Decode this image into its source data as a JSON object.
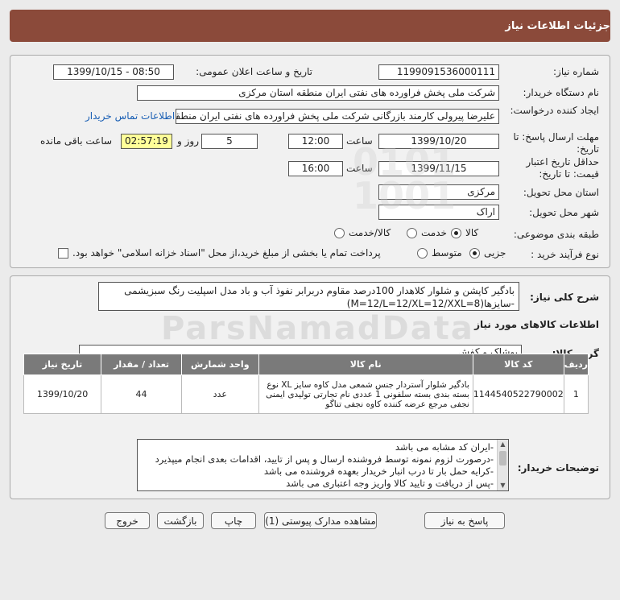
{
  "header": {
    "title": "جزئیات اطلاعات نیاز"
  },
  "form": {
    "need_number_label": "شماره نیاز:",
    "need_number": "1199091536000111",
    "announce_label": "تاریخ و ساعت اعلان عمومی:",
    "announce_value": "1399/10/15 - 08:50",
    "buyer_org_label": "نام دستگاه خریدار:",
    "buyer_org": "شرکت ملی پخش فراورده های نفتی ایران منطقه استان مرکزی",
    "creator_label": "ایجاد کننده درخواست:",
    "creator": "علیرضا پیرولی کارمند بازرگانی شرکت ملی پخش فراورده های نفتی ایران منطقه",
    "contact_link": "اطلاعات تماس خریدار",
    "reply_deadline_label": "مهلت ارسال پاسخ: تا تاریخ:",
    "reply_date": "1399/10/20",
    "time_label": "ساعت",
    "reply_time": "12:00",
    "days_value": "5",
    "days_label": "روز و",
    "remaining_time": "02:57:19",
    "remaining_label": "ساعت باقی مانده",
    "price_validity_label": "حداقل تاریخ اعتبار قیمت: تا تاریخ:",
    "validity_date": "1399/11/15",
    "validity_time": "16:00",
    "province_label": "استان محل تحویل:",
    "province": "مرکزی",
    "city_label": "شهر محل تحویل:",
    "city": "اراک",
    "category_label": "طبقه بندی موضوعی:",
    "category_options": [
      "کالا",
      "خدمت",
      "کالا/خدمت"
    ],
    "process_label": "نوع فرآیند خرید :",
    "process_options": [
      "جزیی",
      "متوسط"
    ],
    "payment_note": "پرداخت تمام یا بخشی از مبلغ خرید،از محل \"اسناد خزانه اسلامی\" خواهد بود."
  },
  "summary": {
    "label": "شرح کلی نیاز:",
    "text": "بادگیر کاپشن و شلوار کلاهدار 100درصد مقاوم دربرابر نفوذ آب و باد مدل اسپلیت  رنگ سبزیشمی -سایزها(M=12/L=12/XL=12/XXL=8)"
  },
  "goods_info": {
    "title": "اطلاعات کالاهای مورد نیاز",
    "group_label": "گروه کالا:",
    "group_value": "پوشاک و کفش"
  },
  "table": {
    "headers": [
      "ردیف",
      "کد کالا",
      "نام کالا",
      "واحد شمارش",
      "تعداد / مقدار",
      "تاریخ نیاز"
    ],
    "rows": [
      {
        "index": "1",
        "code": "1144540522790002",
        "name": "بادگیر شلوار آستردار جنس شمعی مدل کاوه سایز XL نوع بسته بندی بسته سلفونی 1 عددی نام تجارتی تولیدی ایمنی نجفی مرجع عرضه کننده کاوه نجفی تناگو",
        "unit": "عدد",
        "quantity": "44",
        "date": "1399/10/20"
      }
    ]
  },
  "buyer_notes": {
    "label": "توضیحات خریدار:",
    "lines": [
      "-ایران کد مشابه می باشد",
      "-درصورت لزوم نمونه توسط فروشنده ارسال و پس از تایید، اقدامات بعدی انجام میپذیرد",
      "-کرایه حمل بار تا درب انبار خریدار بعهده فروشنده می باشد",
      "-پس از دریافت و تایید کالا واریز وجه اعتباری می باشد"
    ]
  },
  "buttons": {
    "reply": "پاسخ به نیاز",
    "attachments": "مشاهده مدارک پیوستی (1)",
    "print": "چاپ",
    "back": "بازگشت",
    "exit": "خروج"
  }
}
